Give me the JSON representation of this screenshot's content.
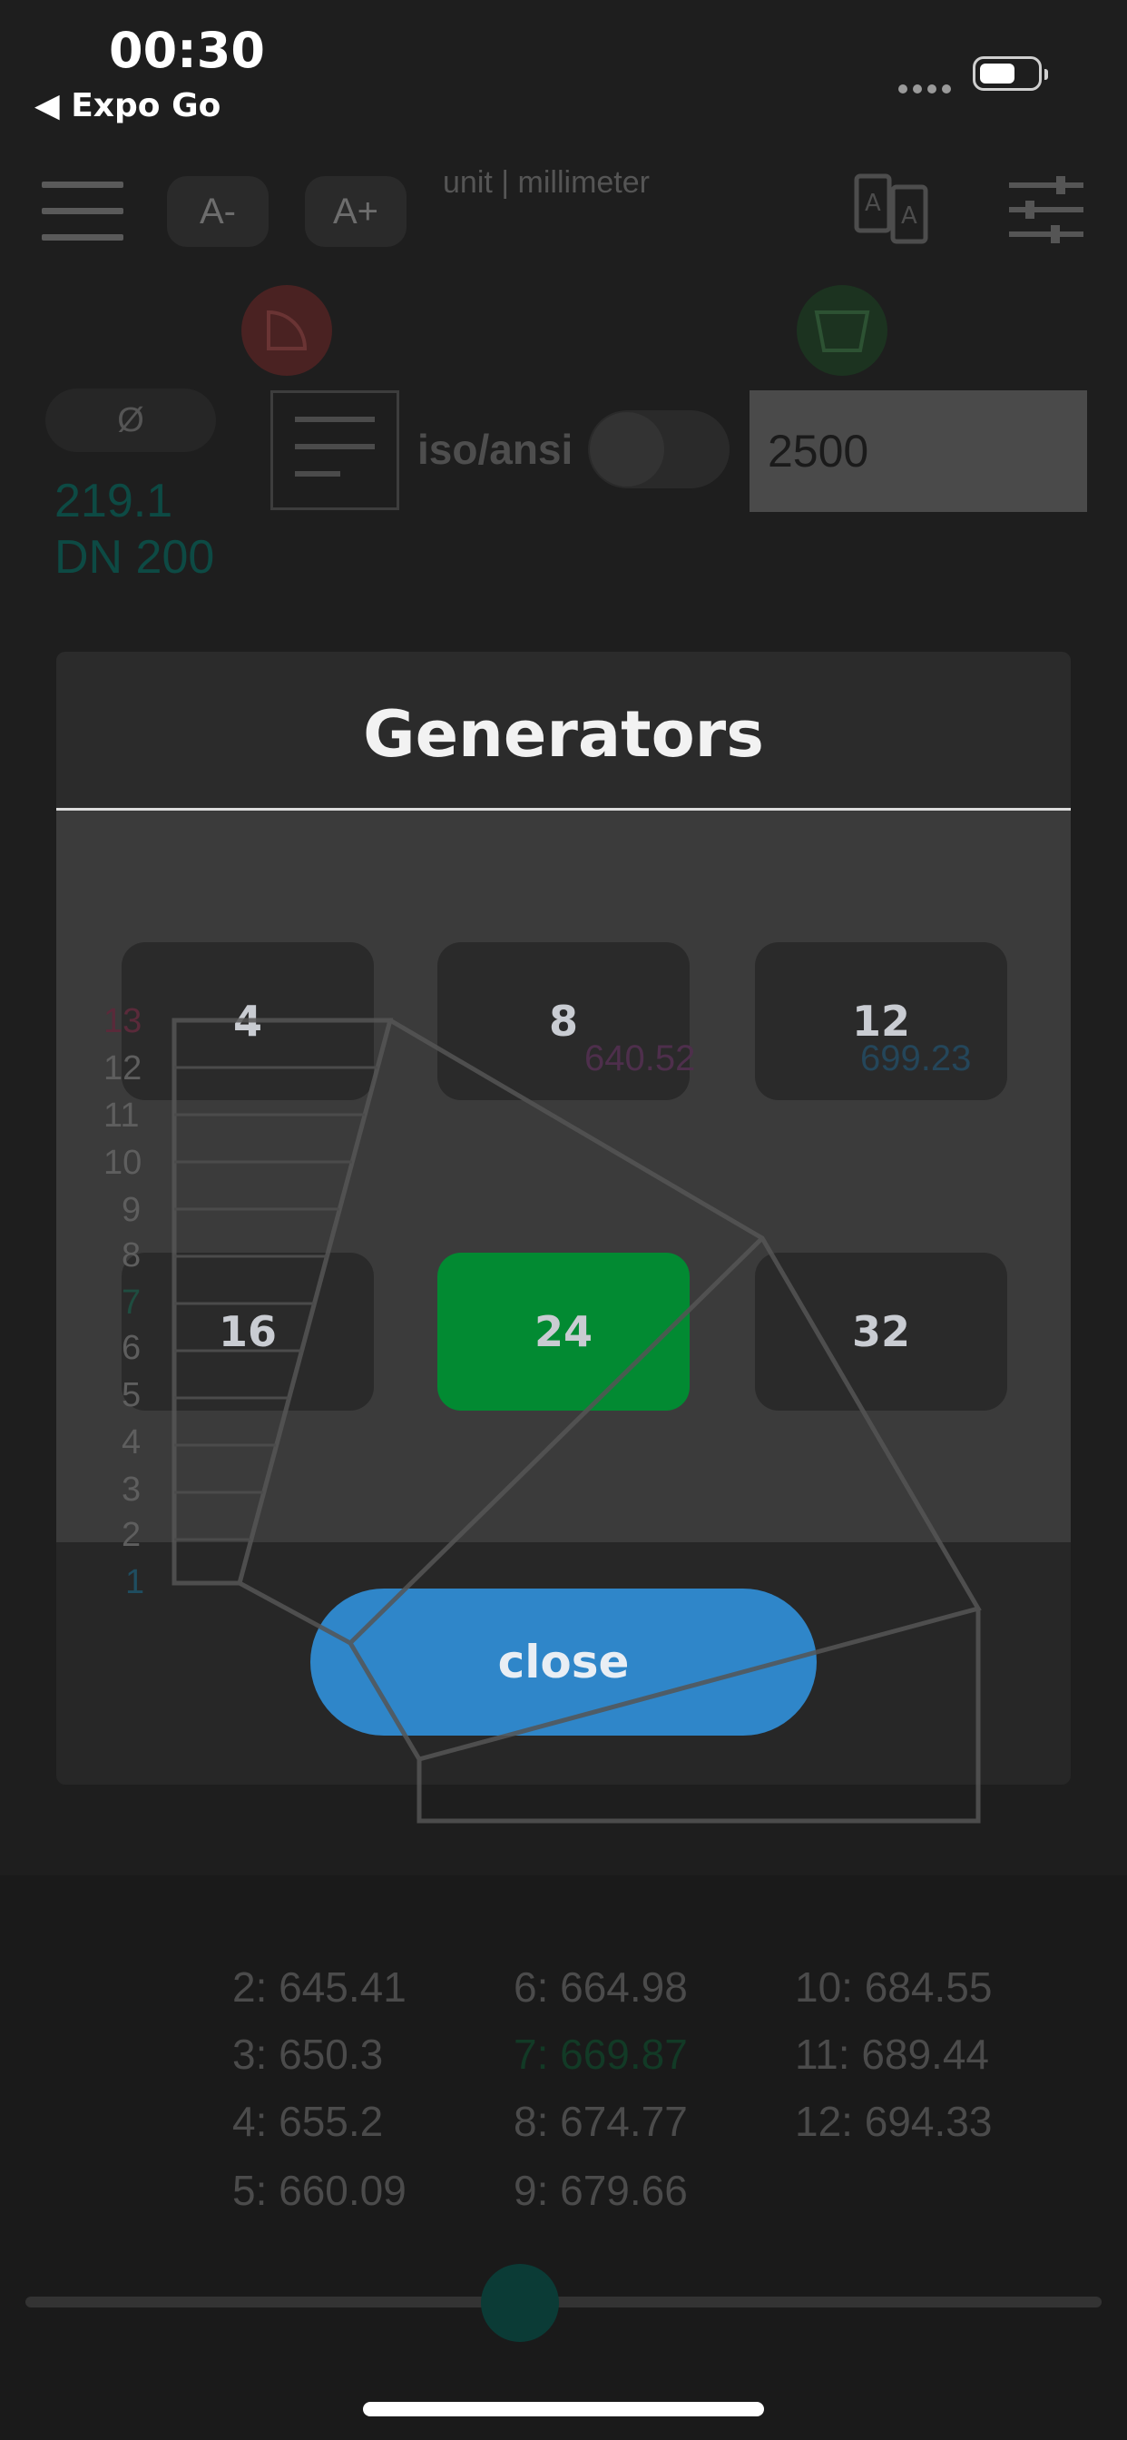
{
  "status": {
    "time": "00:30",
    "back_label": "◀ Expo Go"
  },
  "header": {
    "font_smaller": "A-",
    "font_larger": "A+",
    "unit_label": "unit | millimeter"
  },
  "pipe": {
    "diameter_symbol": "Ø",
    "outer_diameter": "219.1",
    "nominal": "DN 200",
    "standard_label": "iso/ansi",
    "length_value": "2500"
  },
  "modal": {
    "title": "Generators",
    "options": [
      "4",
      "8",
      "12",
      "16",
      "24",
      "32"
    ],
    "selected": "24",
    "close_label": "close"
  },
  "overlay_drawing": {
    "segment_numbers": [
      "13",
      "12",
      "11",
      "10",
      "9",
      "8",
      "7",
      "6",
      "5",
      "4",
      "3",
      "2",
      "1"
    ],
    "value_left": "640.52",
    "value_right": "699.23"
  },
  "results": [
    [
      "2: 645.41",
      "6: 664.98",
      "10: 684.55"
    ],
    [
      "3: 650.3",
      "7: 669.87",
      "11: 689.44"
    ],
    [
      "4: 655.2",
      "8: 674.77",
      "12: 694.33"
    ],
    [
      "5: 660.09",
      "9: 679.66",
      ""
    ]
  ],
  "colors": {
    "selected_green": "#028a32",
    "close_blue": "#2f86c9",
    "accent_teal": "#0d4a44"
  }
}
